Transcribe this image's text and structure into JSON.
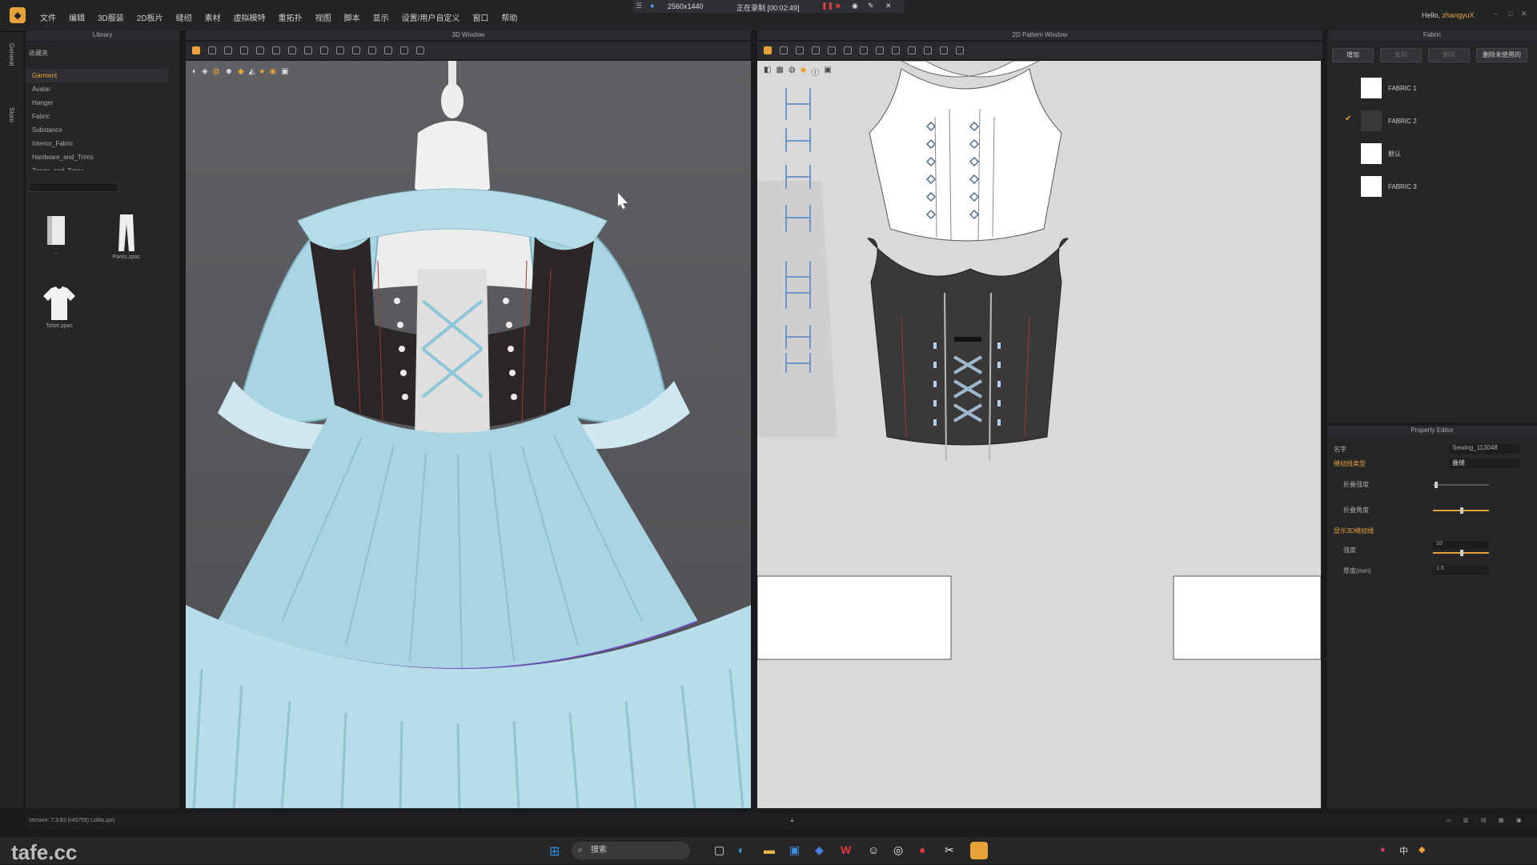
{
  "menubar": {
    "items": [
      "文件",
      "编辑",
      "3D服装",
      "2D板片",
      "缝纫",
      "素材",
      "虚拟模特",
      "重拓扑",
      "视图",
      "脚本",
      "显示",
      "设置/用户自定义",
      "窗口",
      "帮助"
    ],
    "greeting": "Hello,",
    "username": "zhangyuX"
  },
  "recording": {
    "resolution": "2560x1440",
    "status": "正在录制 [00:02:49]"
  },
  "side_tabs": [
    "General",
    "Store"
  ],
  "library": {
    "title": "Library",
    "folder_label": "收藏夹",
    "items": [
      "Garment",
      "Avatar",
      "Hanger",
      "Fabric",
      "Substance",
      "Interior_Fabric",
      "Hardware_and_Trims",
      "Zones_and_Trees"
    ],
    "files": [
      {
        "name": "...",
        "icon": "folder-icon"
      },
      {
        "name": "Pants.zpac",
        "icon": "pants-icon"
      },
      {
        "name": "Tshirt.zpac",
        "icon": "tshirt-icon"
      }
    ]
  },
  "window3d": {
    "title": "3D Window"
  },
  "window2d": {
    "title": "2D Pattern Window"
  },
  "fabric_panel": {
    "title": "Fabric",
    "buttons": [
      "增加",
      "复制",
      "删除",
      "删除未使用的"
    ],
    "items": [
      {
        "name": "FABRIC 1",
        "color": "#ffffff",
        "checked": false
      },
      {
        "name": "FABRIC 2",
        "color": "#3a3a3a",
        "checked": true
      },
      {
        "name": "默认",
        "color": "#ffffff",
        "checked": false
      },
      {
        "name": "FABRIC 3",
        "color": "#ffffff",
        "checked": false
      }
    ]
  },
  "property_editor": {
    "title": "Property Editor",
    "name_label": "名字",
    "name_value": "Sewing_113048",
    "section1": "缝纫线类型",
    "type_value": "叠缝",
    "fold_strength_label": "折叠强度",
    "fold_angle_label": "折叠角度",
    "section2": "显示3D缝纫线",
    "strength_label": "强度",
    "strength_value": "10",
    "thickness_label": "厚度(mm)",
    "thickness_value": "1.5"
  },
  "status": {
    "version_label": "Version:",
    "version": "7.3.83 (r45759)",
    "file": "Lolita.zprj"
  },
  "taskbar": {
    "search_placeholder": "搜索",
    "ime": "中"
  },
  "watermark": "tafe.cc",
  "colors": {
    "accent": "#e8a23a",
    "dress": "#a9d4e1",
    "bodice": "#2b2627",
    "bg3d": "#58595c",
    "bg2d": "#d9d9d9"
  }
}
